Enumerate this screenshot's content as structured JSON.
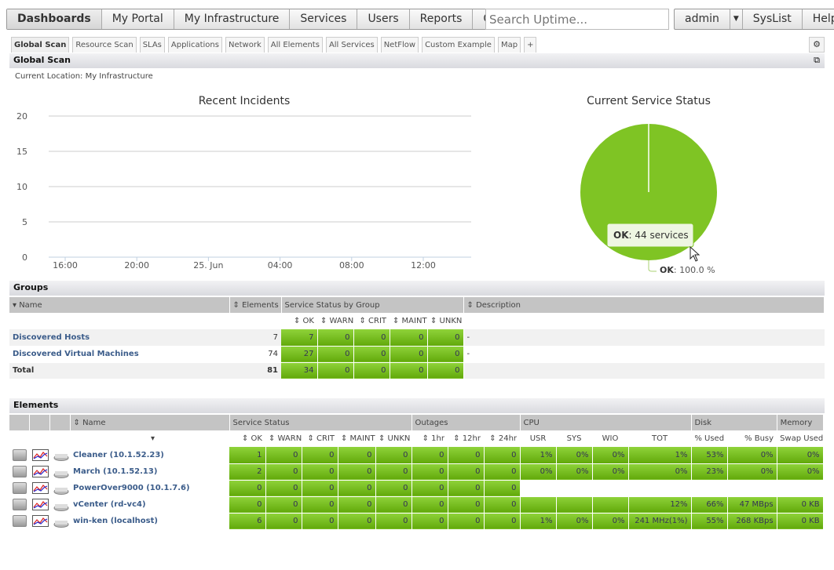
{
  "nav": {
    "items": [
      "Dashboards",
      "My Portal",
      "My Infrastructure",
      "Services",
      "Users",
      "Reports",
      "Config"
    ],
    "active": "Dashboards"
  },
  "search": {
    "placeholder": "Search Uptime..."
  },
  "right_nav": {
    "user": "admin",
    "syslist": "SysList",
    "help": "Help"
  },
  "tabs": [
    "Global Scan",
    "Resource Scan",
    "SLAs",
    "Applications",
    "Network",
    "All Elements",
    "All Services",
    "NetFlow",
    "Custom Example",
    "Map",
    "+"
  ],
  "panel": {
    "title": "Global Scan",
    "location": "Current Location: My Infrastructure"
  },
  "chart_data": [
    {
      "type": "line",
      "title": "Recent Incidents",
      "ylim": [
        0,
        20
      ],
      "yticks": [
        "0",
        "5",
        "10",
        "15",
        "20"
      ],
      "xticks": [
        "16:00",
        "20:00",
        "25. Jun",
        "04:00",
        "08:00",
        "12:00"
      ],
      "grid": true,
      "series": []
    },
    {
      "type": "pie",
      "title": "Current Service Status",
      "slices": [
        {
          "name": "OK",
          "value": 44,
          "percent": 100.0,
          "color": "#7fc424"
        }
      ],
      "tooltip": {
        "label": "OK",
        "text": ": 44 services"
      },
      "data_label": {
        "label": "OK",
        "text": ": 100.0 %"
      }
    }
  ],
  "groups": {
    "title": "Groups",
    "headers": {
      "name": "Name",
      "elements": "Elements",
      "status": "Service Status by Group",
      "description": "Description"
    },
    "status_cols": [
      "OK",
      "WARN",
      "CRIT",
      "MAINT",
      "UNKN"
    ],
    "rows": [
      {
        "name": "Discovered Hosts",
        "elements": "7",
        "status": [
          "7",
          "0",
          "0",
          "0",
          "0"
        ],
        "description": "-"
      },
      {
        "name": "Discovered Virtual Machines",
        "elements": "74",
        "status": [
          "27",
          "0",
          "0",
          "0",
          "0"
        ],
        "description": "-"
      },
      {
        "name": "Total",
        "elements": "81",
        "status": [
          "34",
          "0",
          "0",
          "0",
          "0"
        ],
        "description": ""
      }
    ]
  },
  "elements": {
    "title": "Elements",
    "groups": {
      "name": "Name",
      "status": "Service Status",
      "outages": "Outages",
      "cpu": "CPU",
      "disk": "Disk",
      "memory": "Memory"
    },
    "cols": [
      "OK",
      "WARN",
      "CRIT",
      "MAINT",
      "UNKN",
      "1hr",
      "12hr",
      "24hr",
      "USR",
      "SYS",
      "WIO",
      "TOT",
      "% Used",
      "% Busy",
      "Swap Used"
    ],
    "rows": [
      {
        "name": "Cleaner (10.1.52.23)",
        "icon": "windows-wmi-host-icon",
        "values": [
          "1",
          "0",
          "0",
          "0",
          "0",
          "0",
          "0",
          "0",
          "1%",
          "0%",
          "0%",
          "1%",
          "53%",
          "0%",
          "0%"
        ]
      },
      {
        "name": "March (10.1.52.13)",
        "icon": "linux-host-icon",
        "values": [
          "2",
          "0",
          "0",
          "0",
          "0",
          "0",
          "0",
          "0",
          "0%",
          "0%",
          "0%",
          "0%",
          "23%",
          "0%",
          "0%"
        ]
      },
      {
        "name": "PowerOver9000 (10.1.7.6)",
        "icon": "network-device-icon",
        "values": [
          "0",
          "0",
          "0",
          "0",
          "0",
          "0",
          "0",
          "0",
          null,
          null,
          null,
          null,
          null,
          null,
          null
        ]
      },
      {
        "name": "vCenter (rd-vc4)",
        "icon": "vcenter-icon",
        "values": [
          "0",
          "0",
          "0",
          "0",
          "0",
          "0",
          "0",
          "0",
          "",
          "",
          "",
          "12%",
          "66%",
          "47 MBps",
          "0 KB"
        ]
      },
      {
        "name": "win-ken (localhost)",
        "icon": "windows-agent-host-icon",
        "values": [
          "6",
          "0",
          "0",
          "0",
          "0",
          "0",
          "0",
          "0",
          "1%",
          "0%",
          "0%",
          "241 MHz(1%)",
          "55%",
          "268 KBps",
          "0 KB"
        ]
      }
    ]
  }
}
